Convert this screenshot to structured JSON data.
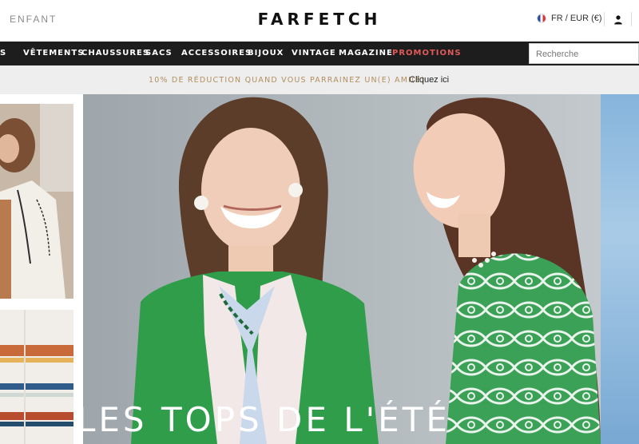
{
  "header": {
    "gender_link": "ENFANT",
    "logo": "FARFETCH",
    "locale": "FR / EUR (€)",
    "icons": {
      "flag": "france-flag-icon",
      "account": "account-icon"
    }
  },
  "nav": {
    "items": [
      {
        "label": "S",
        "promo": false
      },
      {
        "label": "VÊTEMENTS",
        "promo": false
      },
      {
        "label": "CHAUSSURES",
        "promo": false
      },
      {
        "label": "SACS",
        "promo": false
      },
      {
        "label": "ACCESSOIRES",
        "promo": false
      },
      {
        "label": "BIJOUX",
        "promo": false
      },
      {
        "label": "VINTAGE",
        "promo": false
      },
      {
        "label": "MAGAZINE",
        "promo": false
      },
      {
        "label": "PROMOTIONS",
        "promo": true
      }
    ],
    "search_placeholder": "Recherche",
    "promo_color": "#e05a5a"
  },
  "promo_bar": {
    "text": "10% DE RÉDUCTION QUAND VOUS PARRAINEZ UN(E) AMI(E)",
    "link": "Cliquez ici",
    "accent": "#b28f5e"
  },
  "hero": {
    "title": "LES TOPS DE L'ÉTÉ"
  }
}
